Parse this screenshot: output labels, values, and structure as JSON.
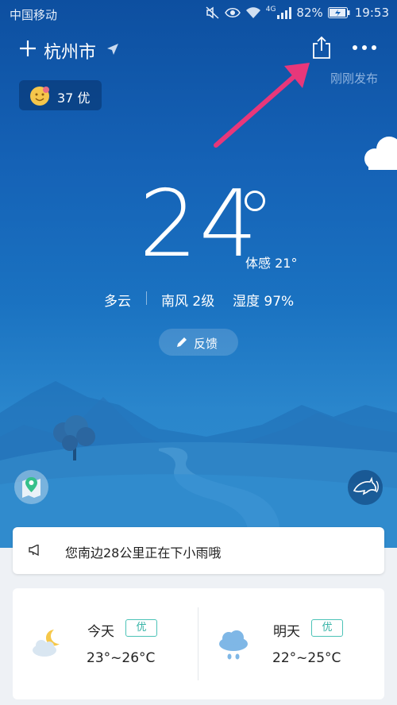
{
  "status_bar": {
    "carrier": "中国移动",
    "battery": "82%",
    "time": "19:53",
    "network": "4G",
    "icons": [
      "mute-icon",
      "eye-icon",
      "wifi-icon",
      "signal-icon",
      "battery-icon"
    ]
  },
  "header": {
    "city": "杭州市",
    "published": "刚刚发布",
    "icons": [
      "plus-icon",
      "location-arrow-icon",
      "share-icon",
      "more-icon"
    ]
  },
  "aqi": {
    "value": "37",
    "level": "优"
  },
  "current": {
    "temperature": "24",
    "feels_like": "体感 21°",
    "condition": "多云",
    "wind": "南风 2级",
    "humidity": "湿度 97%"
  },
  "feedback": {
    "label": "反馈"
  },
  "alert": {
    "text": "您南边28公里正在下小雨哦"
  },
  "forecast": [
    {
      "day": "今天",
      "quality": "优",
      "range": "23°~26°C",
      "icon": "moon-cloud-icon"
    },
    {
      "day": "明天",
      "quality": "优",
      "range": "22°~25°C",
      "icon": "rain-cloud-icon"
    }
  ],
  "colors": {
    "accent_arrow": "#e8377a",
    "badge": "#34b3a6",
    "sky_top": "#0d4fa0",
    "sky_bottom": "#2f8fd0"
  }
}
